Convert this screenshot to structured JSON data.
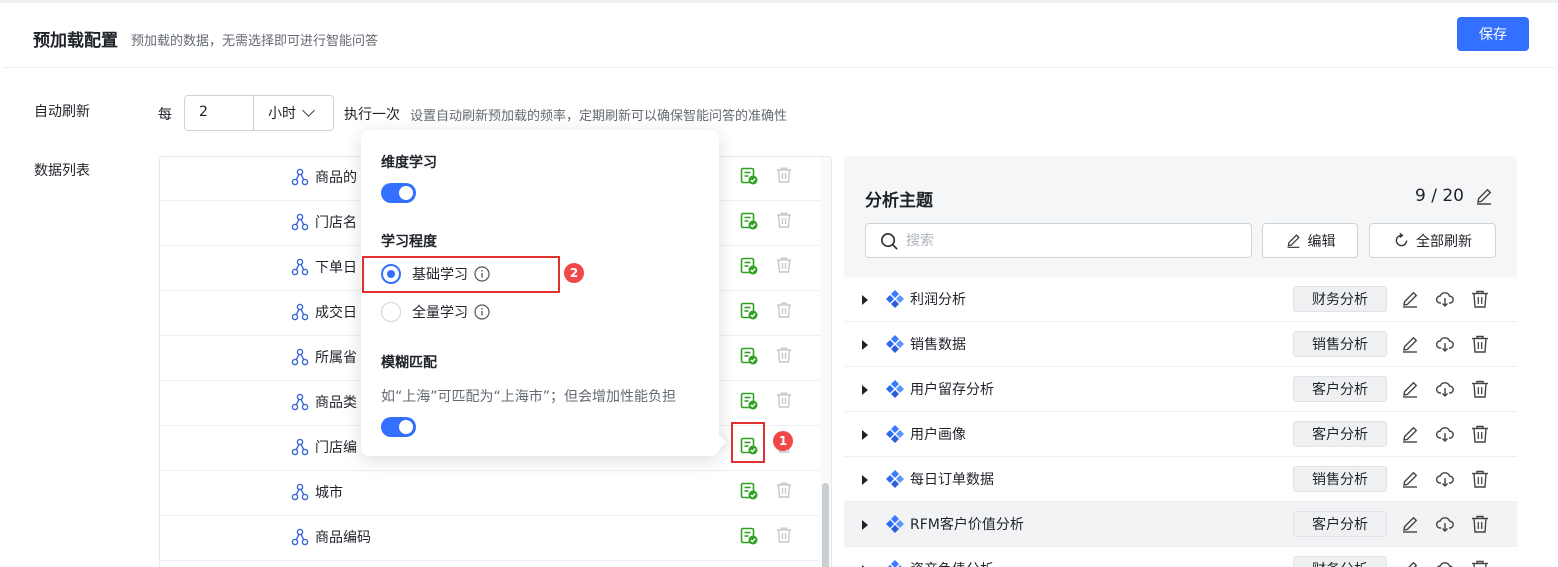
{
  "header": {
    "title": "预加载配置",
    "subtitle": "预加载的数据，无需选择即可进行智能问答",
    "save_label": "保存"
  },
  "auto_refresh": {
    "label": "自动刷新",
    "prefix": "每",
    "value": "2",
    "unit": "小时",
    "suffix": "执行一次",
    "hint": "设置自动刷新预加载的频率，定期刷新可以确保智能问答的准确性"
  },
  "data_list": {
    "label": "数据列表",
    "rows": [
      {
        "name": "商品的"
      },
      {
        "name": "门店名"
      },
      {
        "name": "下单日"
      },
      {
        "name": "成交日"
      },
      {
        "name": "所属省"
      },
      {
        "name": "商品类"
      },
      {
        "name": "门店编"
      },
      {
        "name": "城市"
      },
      {
        "name": "商品编码"
      }
    ]
  },
  "popover": {
    "dimension_learning": "维度学习",
    "dimension_learning_on": true,
    "learning_level": "学习程度",
    "options": [
      "基础学习",
      "全量学习"
    ],
    "selected_option": "基础学习",
    "fuzzy_match": "模糊匹配",
    "fuzzy_hint": "如“上海”可匹配为“上海市”；但会增加性能负担",
    "fuzzy_match_on": true
  },
  "annotations": {
    "badge1": "1",
    "badge2": "2"
  },
  "topics": {
    "title": "分析主题",
    "count": "9 / 20",
    "search_placeholder": "搜索",
    "edit_label": "编辑",
    "refresh_all_label": "全部刷新",
    "items": [
      {
        "name": "利润分析",
        "tag": "财务分析"
      },
      {
        "name": "销售数据",
        "tag": "销售分析"
      },
      {
        "name": "用户留存分析",
        "tag": "客户分析"
      },
      {
        "name": "用户画像",
        "tag": "客户分析"
      },
      {
        "name": "每日订单数据",
        "tag": "销售分析"
      },
      {
        "name": "RFM客户价值分析",
        "tag": "客户分析"
      },
      {
        "name": "资产负债分析",
        "tag": "财务分析"
      }
    ]
  },
  "colors": {
    "primary": "#3370ff",
    "learn_icon": "#2ea121",
    "annotation_red": "#e03030"
  }
}
